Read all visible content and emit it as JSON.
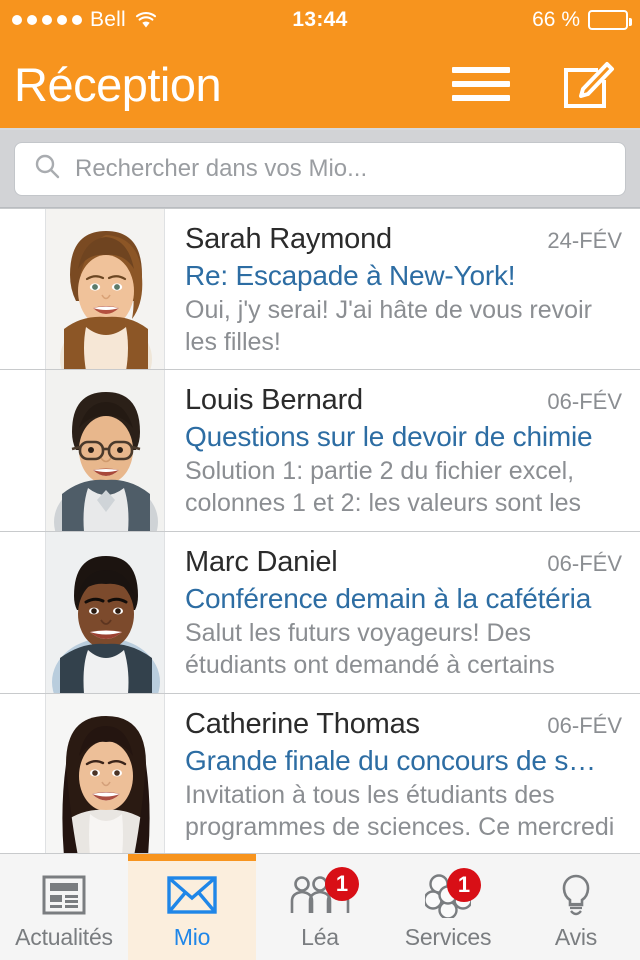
{
  "status_bar": {
    "signal_dots": 5,
    "signal_dots_total": 5,
    "carrier": "Bell",
    "wifi_icon": "wifi-icon",
    "time": "13:44",
    "battery_text": "66 %",
    "battery_percent": 66
  },
  "nav": {
    "title": "Réception",
    "menu_icon": "hamburger-menu-icon",
    "compose_icon": "compose-icon"
  },
  "search": {
    "icon": "search-icon",
    "placeholder": "Rechercher dans vos Mio...",
    "value": ""
  },
  "emails": [
    {
      "sender": "Sarah Raymond",
      "date": "24-FÉV",
      "subject": "Re: Escapade à New-York!",
      "preview": "Oui, j'y serai! J'ai hâte de vous revoir les filles!",
      "avatar": "avatar-sarah-raymond"
    },
    {
      "sender": "Louis Bernard",
      "date": "06-FÉV",
      "subject": "Questions sur le devoir de chimie",
      "preview": "Solution 1: partie 2 du fichier excel, colonnes 1 et 2: les valeurs sont les",
      "avatar": "avatar-louis-bernard"
    },
    {
      "sender": "Marc Daniel",
      "date": "06-FÉV",
      "subject": "Conférence demain à la cafétéria",
      "preview": "Salut les futurs voyageurs! Des étudiants ont demandé à certains",
      "avatar": "avatar-marc-daniel"
    },
    {
      "sender": "Catherine Thomas",
      "date": "06-FÉV",
      "subject": "Grande finale du concours de s…",
      "preview": "Invitation à tous les étudiants des programmes de sciences. Ce mercredi",
      "avatar": "avatar-catherine-thomas"
    }
  ],
  "tabs": [
    {
      "label": "Actualités",
      "icon": "news-icon",
      "active": false,
      "badge": ""
    },
    {
      "label": "Mio",
      "icon": "envelope-icon",
      "active": true,
      "badge": ""
    },
    {
      "label": "Léa",
      "icon": "people-icon",
      "active": false,
      "badge": "1"
    },
    {
      "label": "Services",
      "icon": "flower-icon",
      "active": false,
      "badge": "1"
    },
    {
      "label": "Avis",
      "icon": "lightbulb-icon",
      "active": false,
      "badge": ""
    }
  ],
  "colors": {
    "brand_orange": "#F7941E",
    "subject_blue": "#2d6da3",
    "active_tab_blue": "#1f86e8",
    "badge_red": "#d80f16",
    "active_tab_bg": "#fbeedd"
  }
}
